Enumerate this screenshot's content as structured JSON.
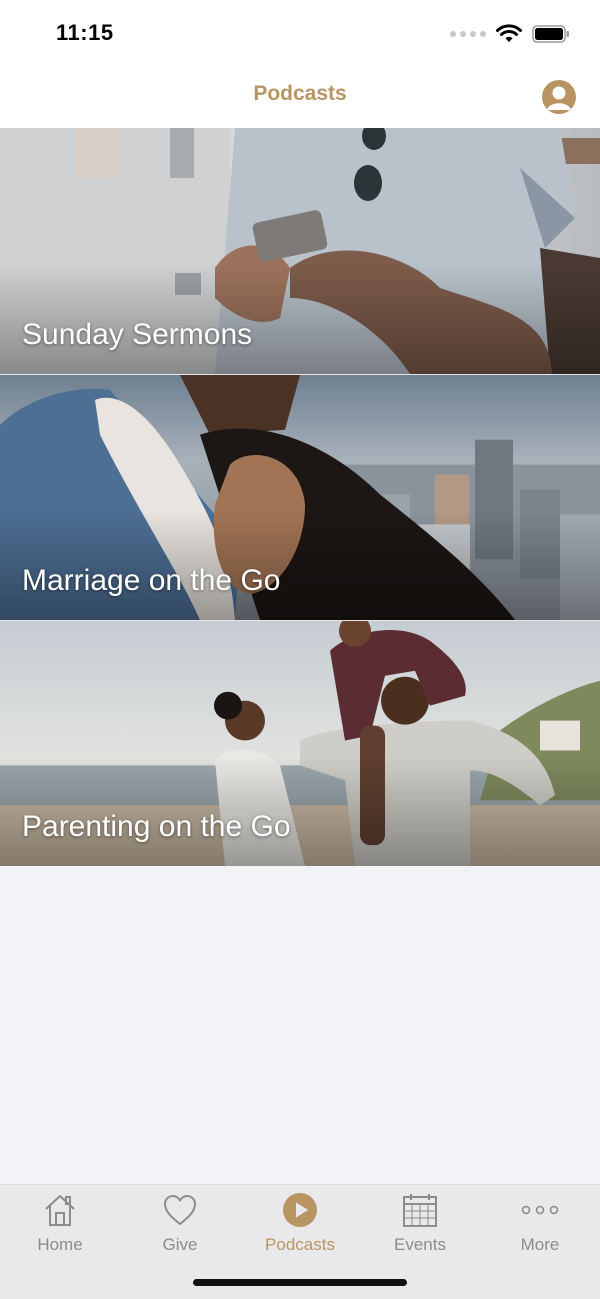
{
  "status_bar": {
    "time": "11:15"
  },
  "nav": {
    "title": "Podcasts"
  },
  "podcasts": [
    {
      "title": "Sunday Sermons"
    },
    {
      "title": "Marriage on the Go"
    },
    {
      "title": "Parenting on the Go"
    }
  ],
  "tabs": [
    {
      "label": "Home",
      "icon": "house-icon"
    },
    {
      "label": "Give",
      "icon": "heart-icon"
    },
    {
      "label": "Podcasts",
      "icon": "play-circle-icon",
      "active": true
    },
    {
      "label": "Events",
      "icon": "calendar-icon"
    },
    {
      "label": "More",
      "icon": "ellipsis-icon"
    }
  ],
  "colors": {
    "accent": "#b89562",
    "tab_inactive": "#8c8c8c",
    "background": "#f2f3f7"
  }
}
